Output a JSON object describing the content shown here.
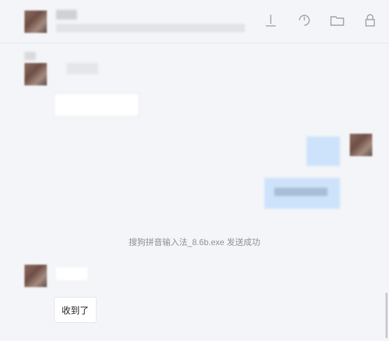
{
  "header": {
    "toolbar_icons": [
      "download-icon",
      "history-icon",
      "folder-icon",
      "lock-icon"
    ]
  },
  "messages": {
    "system_notice": "搜狗拼音输入法_8.6b.exe 发送成功",
    "incoming_reply": "收到了"
  },
  "colors": {
    "background": "#f4f5f8",
    "incoming_bubble": "#ffffff",
    "outgoing_bubble": "#cfe4fb",
    "system_text": "#8d9097"
  }
}
